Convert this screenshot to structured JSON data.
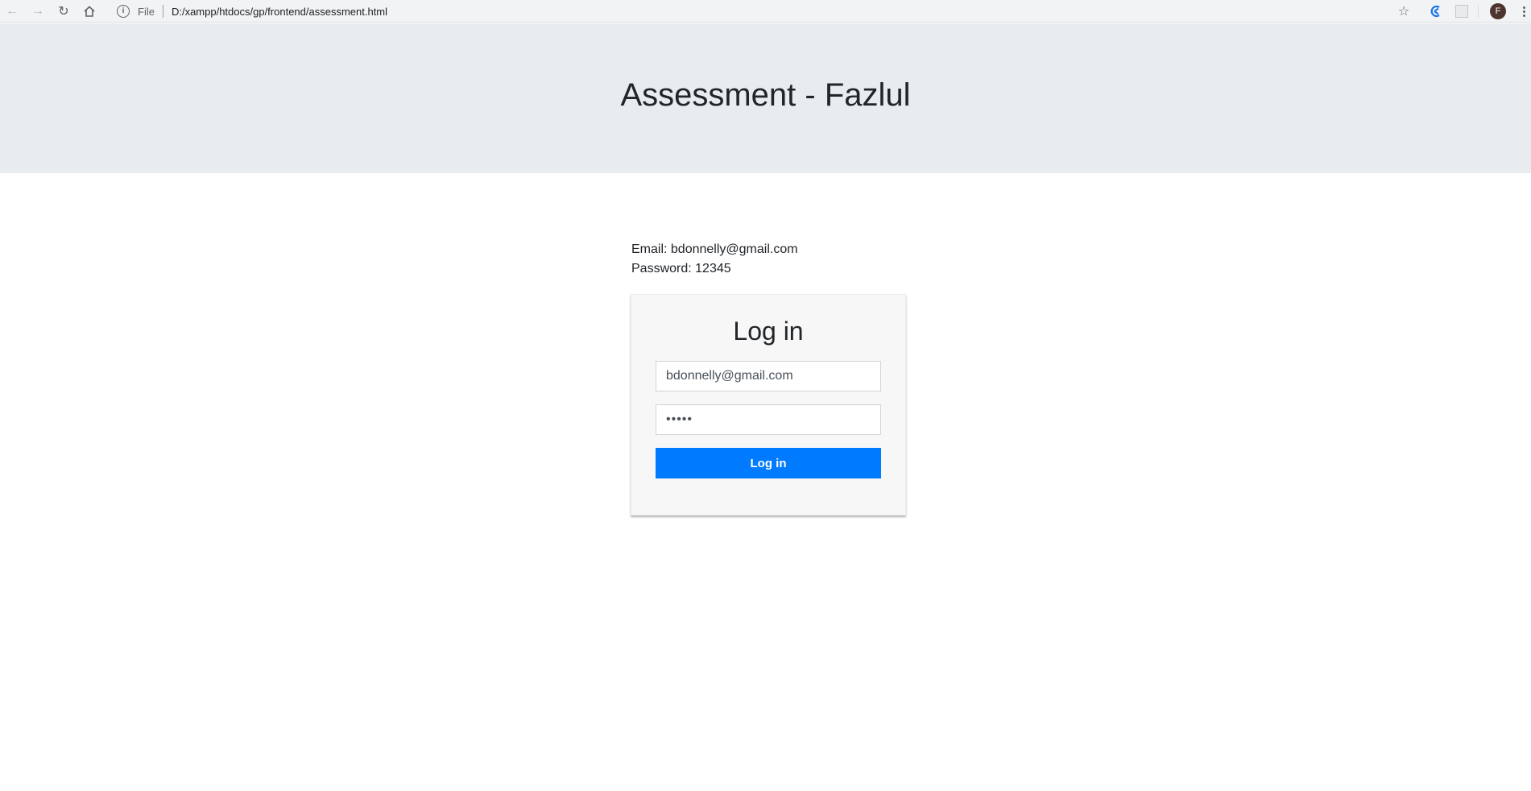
{
  "browser": {
    "back_icon": "arrow-left-icon",
    "forward_icon": "arrow-right-icon",
    "reload_icon": "reload-icon",
    "home_icon": "home-icon",
    "info_icon": "info-icon",
    "scheme_label": "File",
    "url": "D:/xampp/htdocs/gp/frontend/assessment.html",
    "star_icon": "star-icon",
    "extension_icon": "extension-icon",
    "extension2_icon": "extension-placeholder-icon",
    "profile_initial": "F",
    "menu_icon": "kebab-menu-icon"
  },
  "header": {
    "title": "Assessment - Fazlul"
  },
  "hint": {
    "email_line": "Email: bdonnelly@gmail.com",
    "password_line": "Password: 12345"
  },
  "login": {
    "title": "Log in",
    "email_value": "bdonnelly@gmail.com",
    "password_value": "12345",
    "button_label": "Log in"
  },
  "colors": {
    "jumbotron_bg": "#e9ecef",
    "primary": "#007bff",
    "card_bg": "#f7f7f7"
  }
}
